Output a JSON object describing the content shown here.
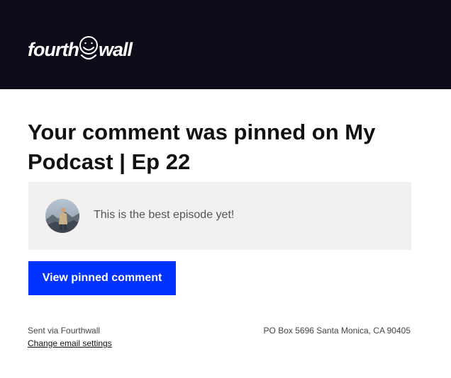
{
  "header": {
    "logo_word1": "fourth",
    "logo_word2": "wall",
    "background_color": "#0d0d1a"
  },
  "email": {
    "headline": "Your comment was pinned on My Podcast | Ep 22",
    "comment": {
      "avatar_icon": "user-avatar-photo",
      "text": "This is the best episode yet!"
    },
    "cta_label": "View pinned comment",
    "cta_color": "#0033ff"
  },
  "footer": {
    "sent_via": "Sent via Fourthwall",
    "settings_link": "Change email settings",
    "address": "PO Box 5696 Santa Monica, CA 90405"
  }
}
